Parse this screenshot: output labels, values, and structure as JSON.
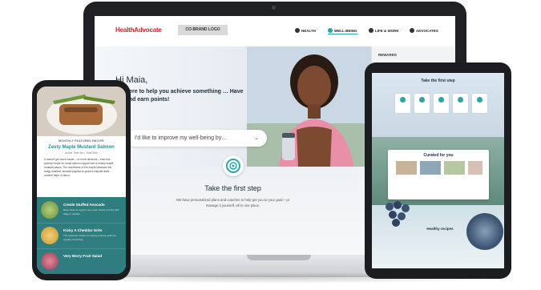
{
  "laptop": {
    "brand_logo": "HealthAdvocate",
    "cobrand_label": "CO-BRAND LOGO",
    "nav": [
      {
        "label": "HEALTH"
      },
      {
        "label": "WELL-BEING"
      },
      {
        "label": "LIFE & WORK"
      },
      {
        "label": "ADVOCATES"
      }
    ],
    "sidebar_header": "REWARDS",
    "greeting": "Hi Maia,",
    "subline": "…e here to help you achieve something … Have fun and earn points!",
    "improve_placeholder": "I'd like to improve my well-being by…",
    "cta_title": "Take the first step",
    "cta_desc": "We have personalized plans and coaches to help get you to your goal – or manage it yourself, all in one place."
  },
  "tablet": {
    "title": "Take the first step",
    "panel_title": "Curated for you",
    "week_label": "Healthy recipes"
  },
  "phone": {
    "month_label": "MONTHLY FEATURED RECIPE",
    "recipe_title": "Zesty Maple Mustard Salmon",
    "recipe_line": "Active Time 5m • Total 30m",
    "recipe_desc": "It doesn't get much easier – or more delicious – than this speedy recipe for moist salmon topped with a smoky maple mustard sauce. The sweetness of the maple balances the tangy mustard, smoked paprika or ground chipotle adds another layer of flavor.",
    "items": [
      {
        "title": "Creole Stuffed Avocado",
        "desc": "Better than an egg for any meal, simply crunchy with ridge or tortillas."
      },
      {
        "title": "Kicky A Cheddar Grits",
        "desc": "The Southern version of creamy polenta, grits are equally comforting."
      },
      {
        "title": "Very Berry Fruit Salad",
        "desc": ""
      }
    ]
  }
}
